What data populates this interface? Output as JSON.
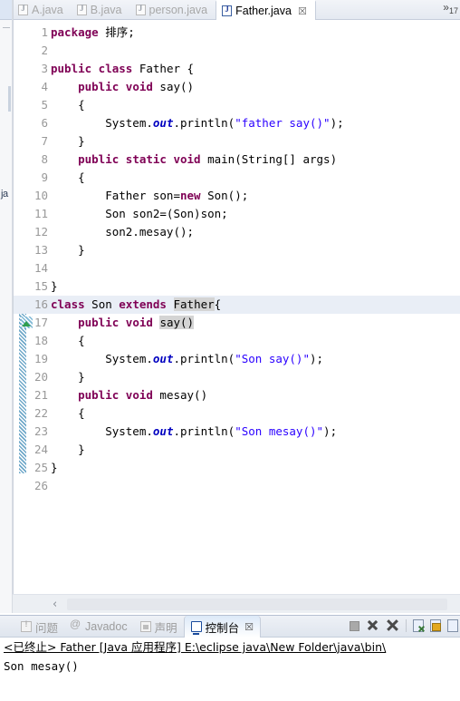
{
  "left_strip": {
    "label": "ja"
  },
  "editor": {
    "tabs": [
      {
        "label": "A.java",
        "active": false,
        "icon": "java-file-icon"
      },
      {
        "label": "B.java",
        "active": false,
        "icon": "java-file-icon"
      },
      {
        "label": "person.java",
        "active": false,
        "icon": "java-file-icon"
      },
      {
        "label": "Father.java",
        "active": true,
        "icon": "java-file-icon",
        "close": "☒"
      }
    ],
    "overflow": {
      "chevron": "»",
      "count": "17"
    },
    "scrollbar": {
      "left_arrow": "‹"
    },
    "code": [
      {
        "n": "1",
        "html": "<span class=\"kw\">package</span> 排序;"
      },
      {
        "n": "2",
        "html": ""
      },
      {
        "n": "3",
        "html": "<span class=\"kw\">public class</span> Father {"
      },
      {
        "n": "4",
        "html": "    <span class=\"kw\">public void</span> say()"
      },
      {
        "n": "5",
        "html": "    {"
      },
      {
        "n": "6",
        "html": "        System.<span class=\"fld\">out</span>.println(<span class=\"str\">\"father say()\"</span>);"
      },
      {
        "n": "7",
        "html": "    }"
      },
      {
        "n": "8",
        "html": "    <span class=\"kw\">public static void</span> main(String[] args)"
      },
      {
        "n": "9",
        "html": "    {"
      },
      {
        "n": "10",
        "html": "        Father son=<span class=\"kw\">new</span> Son();"
      },
      {
        "n": "11",
        "html": "        Son son2=(Son)son;"
      },
      {
        "n": "12",
        "html": "        son2.mesay();"
      },
      {
        "n": "13",
        "html": "    }"
      },
      {
        "n": "14",
        "html": ""
      },
      {
        "n": "15",
        "html": "}"
      },
      {
        "n": "16",
        "html": "<span class=\"kw\">class</span> Son <span class=\"kw\">extends</span> <span class=\"occ\">Father</span>{",
        "current": true
      },
      {
        "n": "17",
        "html": "    <span class=\"kw\">public void</span> <span class=\"occ\">say()</span>"
      },
      {
        "n": "18",
        "html": "    {"
      },
      {
        "n": "19",
        "html": "        System.<span class=\"fld\">out</span>.println(<span class=\"str\">\"Son say()\"</span>);"
      },
      {
        "n": "20",
        "html": "    }"
      },
      {
        "n": "21",
        "html": "    <span class=\"kw\">public void</span> mesay()"
      },
      {
        "n": "22",
        "html": "    {"
      },
      {
        "n": "23",
        "html": "        System.<span class=\"fld\">out</span>.println(<span class=\"str\">\"Son mesay()\"</span>);"
      },
      {
        "n": "24",
        "html": "    }"
      },
      {
        "n": "25",
        "html": "}"
      },
      {
        "n": "26",
        "html": ""
      }
    ]
  },
  "console": {
    "tabs": [
      {
        "label": "问题",
        "active": false,
        "icon": "problems-icon"
      },
      {
        "label": "Javadoc",
        "active": false,
        "icon": "javadoc-icon"
      },
      {
        "label": "声明",
        "active": false,
        "icon": "declaration-icon"
      },
      {
        "label": "控制台",
        "active": true,
        "icon": "console-icon",
        "close": "☒"
      }
    ],
    "toolbar": [
      {
        "name": "terminate-button",
        "title": "终止"
      },
      {
        "name": "remove-launch-button",
        "title": "移除已启动"
      },
      {
        "name": "remove-all-launches-button",
        "title": "移除全部已终止的启动"
      },
      {
        "name": "clear-console-button",
        "title": "清除控制台"
      },
      {
        "name": "scroll-lock-button",
        "title": "滚动锁定"
      },
      {
        "name": "word-wrap-button",
        "title": "自动换行"
      }
    ],
    "header_line": "<已终止> Father [Java 应用程序] E:\\eclipse java\\New Folder\\java\\bin\\",
    "output": "Son mesay()"
  }
}
